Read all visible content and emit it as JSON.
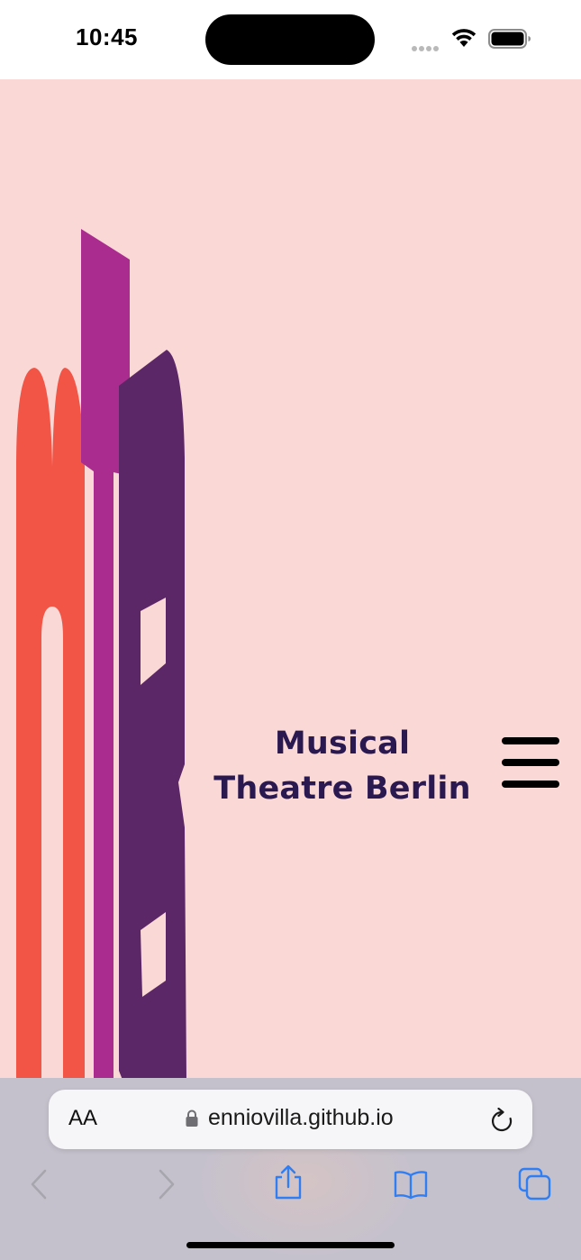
{
  "status_bar": {
    "time": "10:45"
  },
  "site": {
    "title": "Musical Theatre Berlin",
    "background_color": "#f9d8d6",
    "title_color": "#2a1850",
    "logo_colors": [
      "#f25446",
      "#aa2c8e",
      "#5c2766"
    ]
  },
  "safari": {
    "text_size_label": "AA",
    "url": "enniovilla.github.io",
    "accent_color": "#2f7ef4"
  },
  "icons": {
    "wifi": "wifi-icon",
    "battery": "battery-icon",
    "menu": "hamburger-menu-icon",
    "lock": "lock-icon",
    "reload": "reload-icon",
    "back": "chevron-left-icon",
    "forward": "chevron-right-icon",
    "share": "share-icon",
    "bookmarks": "book-icon",
    "tabs": "tabs-icon"
  }
}
